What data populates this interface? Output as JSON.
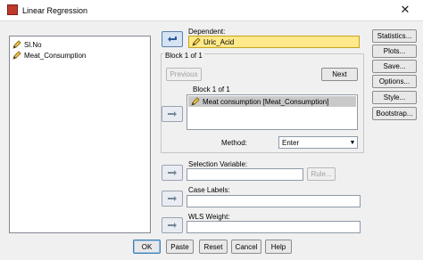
{
  "window": {
    "title": "Linear Regression",
    "close_glyph": "✕"
  },
  "variables": [
    {
      "name": "Sl.No"
    },
    {
      "name": "Meat_Consumption"
    }
  ],
  "dependent": {
    "label": "Dependent:",
    "value": "Uric_Acid"
  },
  "block": {
    "group_title": "Block 1 of 1",
    "inner_label": "Block 1 of 1",
    "previous_label": "Previous",
    "next_label": "Next",
    "independents": [
      "Meat consumption [Meat_Consumption]"
    ]
  },
  "method": {
    "label": "Method:",
    "value": "Enter"
  },
  "selection_variable": {
    "label": "Selection Variable:",
    "value": "",
    "rule_label": "Rule..."
  },
  "case_labels": {
    "label": "Case Labels:",
    "value": ""
  },
  "wls_weight": {
    "label": "WLS Weight:",
    "value": ""
  },
  "side_buttons": [
    "Statistics...",
    "Plots...",
    "Save...",
    "Options...",
    "Style...",
    "Bootstrap..."
  ],
  "bottom_buttons": [
    "OK",
    "Paste",
    "Reset",
    "Cancel",
    "Help"
  ],
  "colors": {
    "selected_field": "#ffe98a",
    "selected_list_item": "#c9c9c9",
    "default_button_border": "#3c7fb1"
  }
}
